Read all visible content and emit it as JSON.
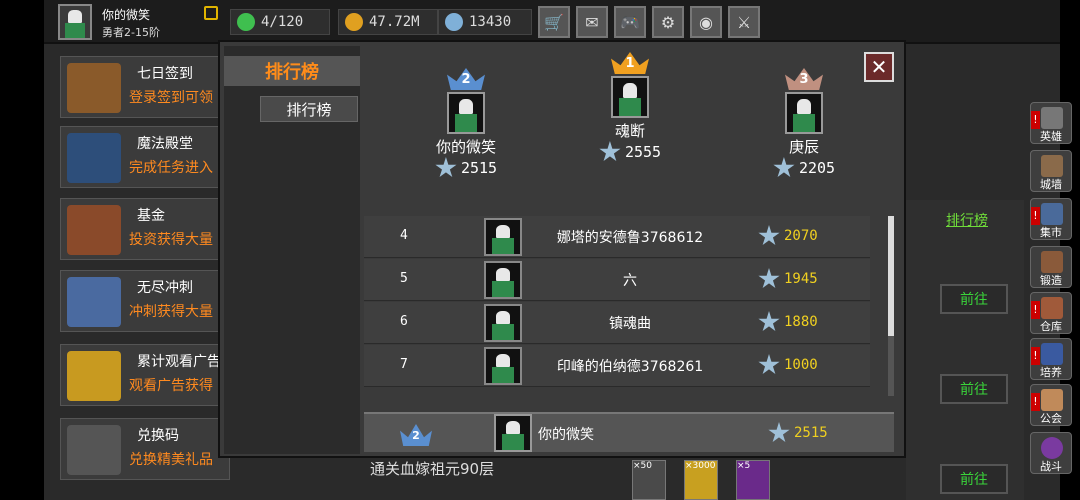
{
  "player": {
    "name": "你的微笑",
    "rank": "勇者2-15阶"
  },
  "resources": [
    {
      "icon": "stamina-icon",
      "value": "4/120",
      "color": "#3fbf4f"
    },
    {
      "icon": "gold-coin-icon",
      "value": "47.72M",
      "color": "#e0a020"
    },
    {
      "icon": "diamond-icon",
      "value": "13430",
      "color": "#7fb0d8"
    }
  ],
  "toolbar": [
    "cart-icon",
    "mail-icon",
    "gamepad-icon",
    "gear-icon",
    "wheel-icon",
    "sword-icon"
  ],
  "activities": [
    {
      "title": "七日签到",
      "subtitle": "登录签到可领",
      "color": "#8a5a2a"
    },
    {
      "title": "魔法殿堂",
      "subtitle": "完成任务进入",
      "color": "#2d4e7a"
    },
    {
      "title": "基金",
      "subtitle": "投资获得大量",
      "color": "#8a4a2a"
    },
    {
      "title": "无尽冲刺",
      "subtitle": "冲刺获得大量",
      "color": "#4a6aa0"
    },
    {
      "title": "累计观看广告",
      "subtitle": "观看广告获得",
      "color": "#c89a20"
    },
    {
      "title": "兑换码",
      "subtitle": "兑换精美礼品",
      "color": "#555555"
    }
  ],
  "sidebar": [
    {
      "label": "英雄",
      "icon": "helmet-icon",
      "alert": true
    },
    {
      "label": "城墙",
      "icon": "wall-icon",
      "alert": false
    },
    {
      "label": "集市",
      "icon": "market-icon",
      "alert": true
    },
    {
      "label": "锻造",
      "icon": "anvil-icon",
      "alert": false
    },
    {
      "label": "仓库",
      "icon": "warehouse-icon",
      "alert": true
    },
    {
      "label": "培养",
      "icon": "potion-icon",
      "alert": true
    },
    {
      "label": "公会",
      "icon": "guild-icon",
      "alert": true
    },
    {
      "label": "战斗",
      "icon": "portal-icon",
      "alert": false
    }
  ],
  "background": {
    "rank_link": "排行榜",
    "go_label": "前往",
    "stage_text": "通关血嫁祖元90层",
    "item_counts": [
      "×50",
      "×3000",
      "×5"
    ]
  },
  "modal": {
    "title": "排行榜",
    "tab": "排行榜",
    "close": "✕",
    "podium": [
      {
        "rank": "2",
        "name": "你的微笑",
        "score": "2515",
        "crown_color": "#5a8fd0"
      },
      {
        "rank": "1",
        "name": "魂断",
        "score": "2555",
        "crown_color": "#f0a020"
      },
      {
        "rank": "3",
        "name": "庚辰",
        "score": "2205",
        "crown_color": "#c09080"
      }
    ],
    "rows": [
      {
        "rank": "4",
        "name": "娜塔的安德鲁3768612",
        "score": "2070"
      },
      {
        "rank": "5",
        "name": "六",
        "score": "1945"
      },
      {
        "rank": "6",
        "name": "镇魂曲",
        "score": "1880"
      },
      {
        "rank": "7",
        "name": "印峰的伯纳德3768261",
        "score": "1000"
      }
    ],
    "mine": {
      "rank": "2",
      "name": "你的微笑",
      "score": "2515"
    }
  }
}
